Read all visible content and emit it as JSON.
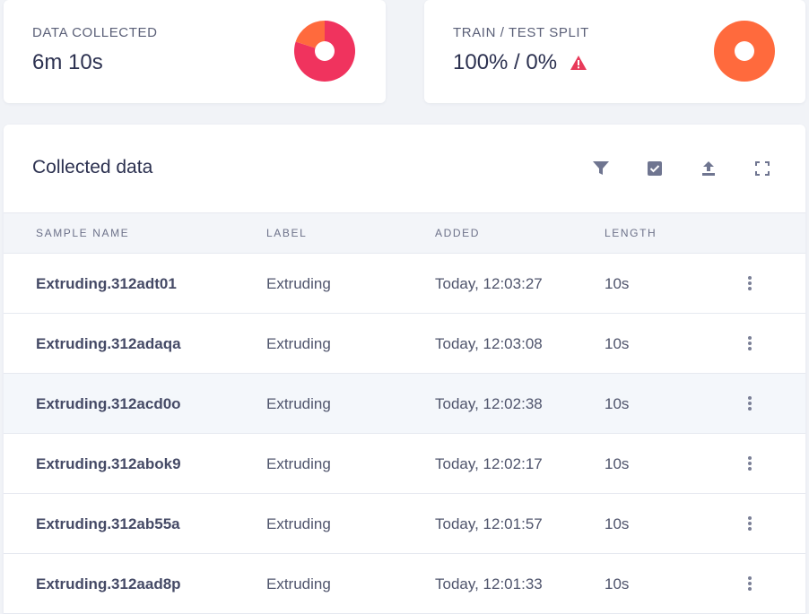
{
  "stats": {
    "data_collected": {
      "label": "DATA COLLECTED",
      "value": "6m 10s",
      "chart": {
        "type": "pie",
        "slices": [
          0.8,
          0.2
        ],
        "colors": [
          "#f0335e",
          "#ff6a3d"
        ]
      }
    },
    "split": {
      "label": "TRAIN / TEST SPLIT",
      "value": "100% / 0%",
      "warning_icon": "warning-triangle-icon",
      "warning_color": "#e83a5a",
      "chart": {
        "type": "pie",
        "slices": [
          1.0,
          0.0
        ],
        "colors": [
          "#ff6a3d",
          "#f0335e"
        ]
      }
    }
  },
  "collected": {
    "title": "Collected data",
    "toolbar_icons": [
      "filter-icon",
      "select-checkbox-icon",
      "upload-icon",
      "fullscreen-icon"
    ],
    "columns": [
      "SAMPLE NAME",
      "LABEL",
      "ADDED",
      "LENGTH"
    ],
    "rows": [
      {
        "name": "Extruding.312adt01",
        "label": "Extruding",
        "added": "Today, 12:03:27",
        "length": "10s"
      },
      {
        "name": "Extruding.312adaqa",
        "label": "Extruding",
        "added": "Today, 12:03:08",
        "length": "10s"
      },
      {
        "name": "Extruding.312acd0o",
        "label": "Extruding",
        "added": "Today, 12:02:38",
        "length": "10s"
      },
      {
        "name": "Extruding.312abok9",
        "label": "Extruding",
        "added": "Today, 12:02:17",
        "length": "10s"
      },
      {
        "name": "Extruding.312ab55a",
        "label": "Extruding",
        "added": "Today, 12:01:57",
        "length": "10s"
      },
      {
        "name": "Extruding.312aad8p",
        "label": "Extruding",
        "added": "Today, 12:01:33",
        "length": "10s"
      }
    ]
  }
}
